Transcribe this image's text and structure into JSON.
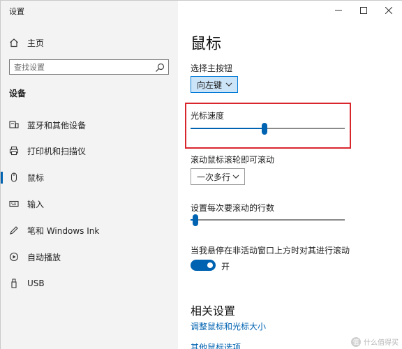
{
  "window": {
    "title": "设置"
  },
  "sidebar": {
    "home_label": "主页",
    "search_placeholder": "查找设置",
    "section_title": "设备",
    "items": [
      {
        "label": "蓝牙和其他设备",
        "icon": "bluetooth-devices-icon"
      },
      {
        "label": "打印机和扫描仪",
        "icon": "printer-icon"
      },
      {
        "label": "鼠标",
        "icon": "mouse-icon",
        "active": true
      },
      {
        "label": "输入",
        "icon": "keyboard-icon"
      },
      {
        "label": "笔和 Windows Ink",
        "icon": "pen-icon"
      },
      {
        "label": "自动播放",
        "icon": "autoplay-icon"
      },
      {
        "label": "USB",
        "icon": "usb-icon"
      }
    ]
  },
  "main": {
    "title": "鼠标",
    "primary_button": {
      "label": "选择主按钮",
      "value": "向左键"
    },
    "cursor_speed": {
      "label": "光标速度",
      "value_fraction": 0.48
    },
    "wheel_scroll": {
      "label": "滚动鼠标滚轮即可滚动",
      "value": "一次多行"
    },
    "lines_per_scroll": {
      "label": "设置每次要滚动的行数",
      "value_fraction": 0.03
    },
    "inactive_scroll": {
      "label": "当我悬停在非活动窗口上方时对其进行滚动",
      "state": "开"
    },
    "related": {
      "title": "相关设置",
      "links": [
        "调整鼠标和光标大小",
        "其他鼠标选项"
      ]
    }
  },
  "watermark": "什么值得买",
  "colors": {
    "accent": "#0063b1",
    "highlight_border": "#d9262c",
    "sidebar_bg": "#f3f3f3"
  }
}
